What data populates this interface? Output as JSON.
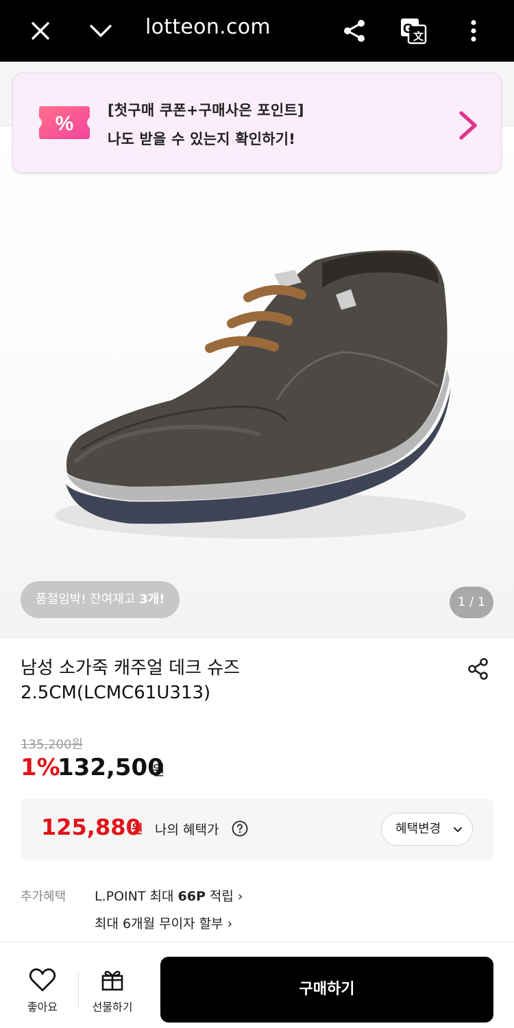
{
  "browser": {
    "url": "lotteon.com"
  },
  "promo": {
    "line1": "[첫구매 쿠폰+구매사은 포인트]",
    "line2": "나도 받을 수 있는지 확인하기!",
    "coupon_symbol": "%"
  },
  "gallery": {
    "stock_text": "품절임박! 잔여재고 ",
    "stock_count": "3개!",
    "page_indicator": "1 / 1"
  },
  "product": {
    "title_line1": "남성 소가죽 캐주얼 데크 슈즈",
    "title_line2": "2.5CM(LCMC61U313)",
    "original_price": "135,200원",
    "discount": "1%",
    "price": "132,500",
    "price_unit": "원"
  },
  "benefit": {
    "price": "125,880",
    "unit": "원",
    "label": "나의 혜택가",
    "change_button": "혜택변경"
  },
  "extra": {
    "label": "추가혜택",
    "line1_prefix": "L.POINT 최대 ",
    "line1_bold": "66P",
    "line1_suffix": " 적립 ›",
    "line2": "최대 6개월 무이자 할부 ›"
  },
  "bottom_bar": {
    "like_label": "좋아요",
    "gift_label": "선물하기",
    "buy_label": "구매하기"
  },
  "colors": {
    "accent_red": "#e0141a",
    "promo_bg": "#fbeefa",
    "arrow_pink": "#e0358f"
  }
}
